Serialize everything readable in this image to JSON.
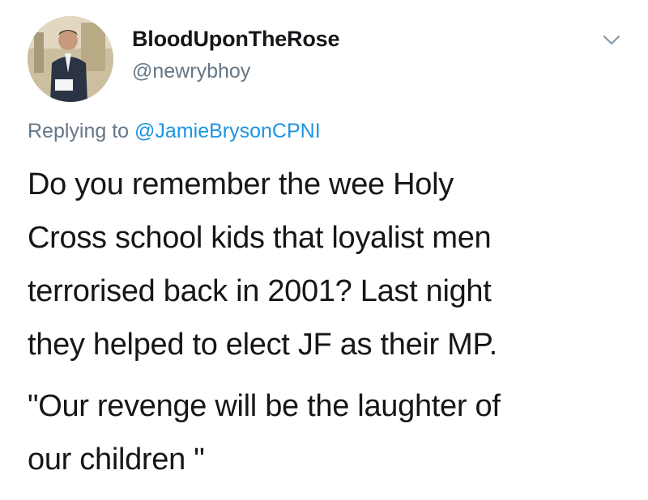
{
  "tweet": {
    "display_name": "BloodUponTheRose",
    "handle": "@newrybhoy",
    "replying_prefix": "Replying to",
    "replying_to": "@JamieBrysonCPNI",
    "body_lines": [
      "Do you remember the wee Holy",
      "Cross school kids that loyalist men",
      "terrorised back in 2001? Last night",
      "they helped to elect JF as their MP."
    ],
    "quote_lines": [
      "\"Our revenge will be the laughter of",
      "our children \""
    ]
  },
  "icons": {
    "avatar": "profile-photo",
    "menu": "chevron-down-icon"
  },
  "colors": {
    "secondary_text": "#657786",
    "link": "#1b95e0",
    "primary_text": "#14171a"
  }
}
